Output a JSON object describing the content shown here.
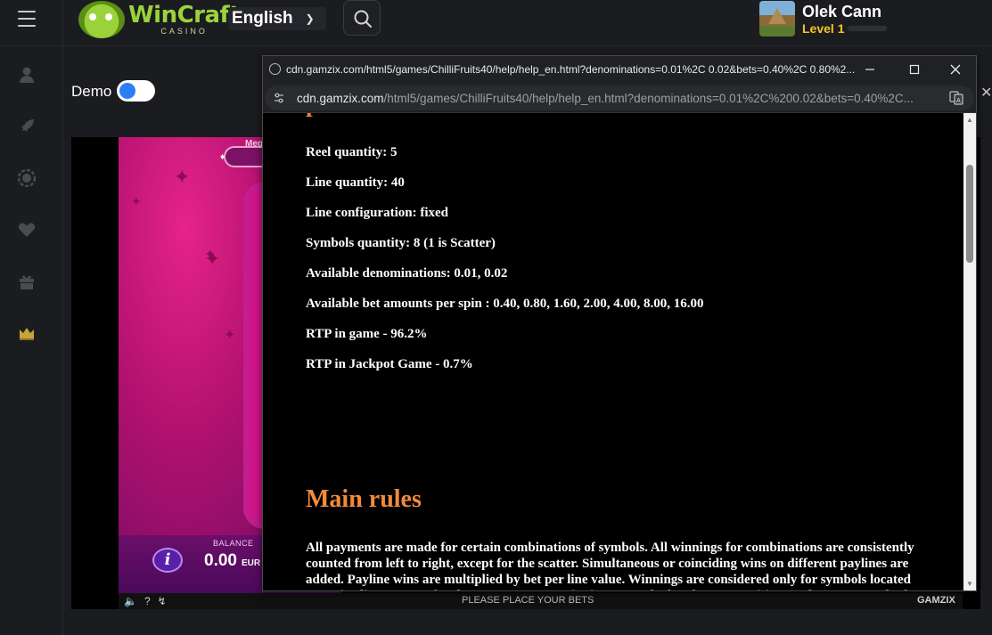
{
  "header": {
    "menu_icon": "hamburger-icon",
    "logo_brand": "WinCraft",
    "logo_sub": "CASINO",
    "language": "English",
    "search_icon": "search-icon",
    "user_name": "Olek Cann",
    "user_level": "Level 1"
  },
  "sidebar": {
    "icons": [
      "user-icon",
      "rocket-icon",
      "casino-chip-icon",
      "heart-icon",
      "gift-icon",
      "crown-icon"
    ]
  },
  "demo": {
    "label": "Demo",
    "enabled": true
  },
  "game": {
    "balance_label": "BALANCE",
    "balance_value": "0.00",
    "currency": "EUR",
    "mega_label": "Meg",
    "footer_message": "PLEASE PLACE YOUR BETS",
    "footer_brand": "GAMZIX"
  },
  "popup": {
    "window_title": "cdn.gamzix.com/html5/games/ChilliFruits40/help/help_en.html?denominations=0.01%2C 0.02&bets=0.40%2C 0.80%2...",
    "url_host": "cdn.gamzix.com",
    "url_path": "/html5/games/ChilliFruits40/help/help_en.html?denominations=0.01%2C%200.02&bets=0.40%2C...",
    "params": [
      "Reel quantity: 5",
      "Line quantity: 40",
      "Line configuration: fixed",
      "Symbols quantity: 8 (1 is Scatter)",
      "Available denominations: 0.01, 0.02",
      "Available bet amounts per spin : 0.40, 0.80, 1.60, 2.00, 4.00, 8.00, 16.00",
      "RTP in game - 96.2%",
      "RTP in Jackpot Game - 0.7%"
    ],
    "main_rules_heading": "Main rules",
    "main_rules_text": "All payments are made for certain combinations of symbols. All winnings for combinations are consistently counted from left to right, except for the scatter. Simultaneous or coinciding wins on different paylines are added. Payline wins are multiplied by bet per line value. Winnings are considered only for symbols located on active lines, except for the scatter. Scatter winnings are calculated at any position on the screen. Only the highest winnings are paid for winnings on each active line and for the combination of scatters. Scatter winnings are added to winnings for the lines. If lines in game are not fixed - you can change lines by clicking mouse at bullitts with lines amount in"
  }
}
